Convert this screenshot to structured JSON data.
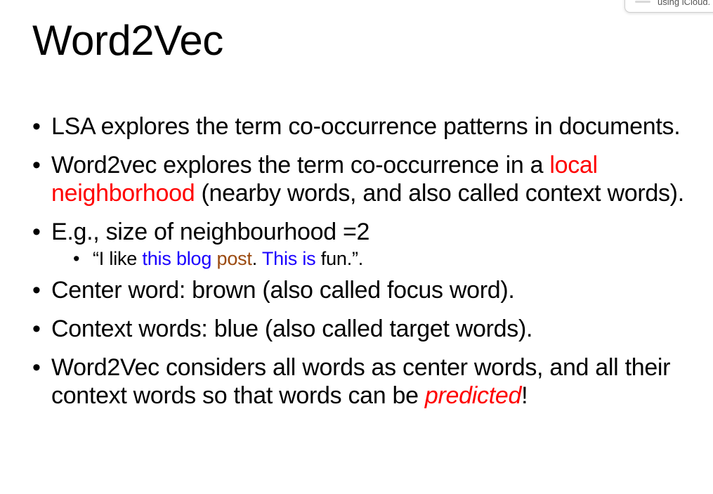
{
  "notification": {
    "text": "using iCloud."
  },
  "slide": {
    "title": "Word2Vec",
    "bullets": [
      {
        "text": "LSA explores the term co-occurrence patterns in documents."
      },
      {
        "part1": "Word2vec explores the term co-occurrence in a ",
        "highlight": "local neighborhood",
        "part2": " (nearby words, and also called context words)."
      },
      {
        "text": "E.g., size of neighbourhood =2",
        "sub": {
          "open": "“I like ",
          "context1": "this blog",
          "space1": " ",
          "center": "post",
          "dot1": ". ",
          "context2": "This is",
          "close": " fun.”."
        }
      },
      {
        "text": "Center word: brown (also called focus word)."
      },
      {
        "text": "Context words: blue (also called target words)."
      },
      {
        "part1": "Word2Vec considers all words as center words, and all their context words so that words can be ",
        "highlight": "predicted",
        "part2": "!"
      }
    ]
  },
  "colors": {
    "highlight_red": "#ff0000",
    "context_blue": "#1a00ff",
    "center_brown": "#9b4a10"
  }
}
